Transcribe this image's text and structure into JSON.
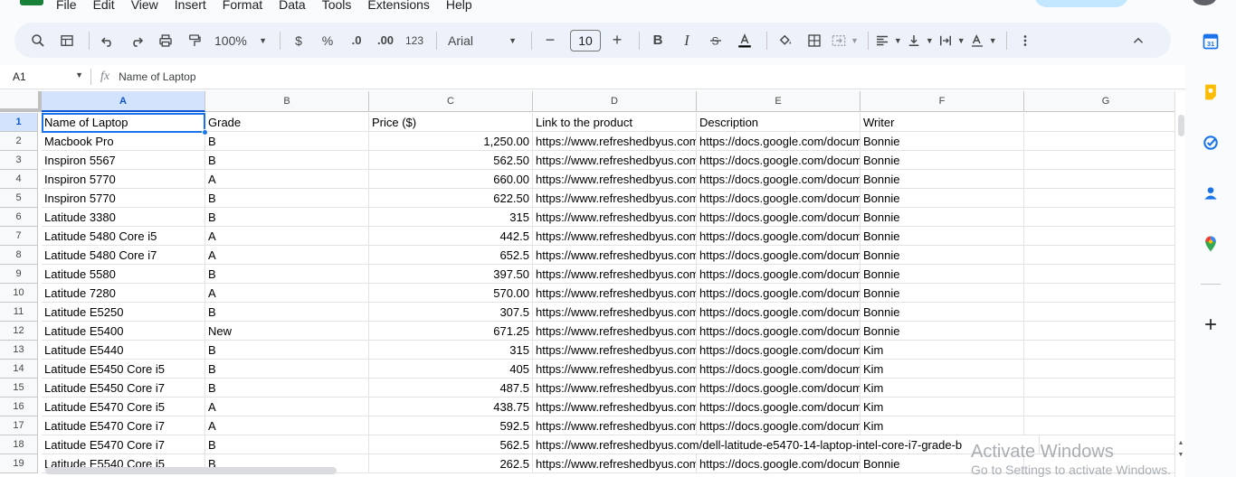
{
  "menu": [
    "File",
    "Edit",
    "View",
    "Insert",
    "Format",
    "Data",
    "Tools",
    "Extensions",
    "Help"
  ],
  "toolbar": {
    "zoom": "100%",
    "currency": "$",
    "percent": "%",
    "decrease_decimal": ".0",
    "increase_decimal": ".00",
    "more_formats": "123",
    "font_family": "Arial",
    "font_size": "10",
    "minus": "−",
    "plus": "+",
    "bold": "B",
    "italic": "I"
  },
  "formula_bar": {
    "name_box": "A1",
    "fx": "fx",
    "value": "Name of Laptop"
  },
  "columns": [
    "A",
    "B",
    "C",
    "D",
    "E",
    "F",
    "G"
  ],
  "rows": [
    {
      "n": "1",
      "a": "Name of Laptop",
      "b": "Grade",
      "c": "Price ($)",
      "d": "Link to the product",
      "e": "Description",
      "f": "Writer"
    },
    {
      "n": "2",
      "a": "Macbook Pro",
      "b": "B",
      "c": "1,250.00",
      "d": "https://www.refreshedbyus.com",
      "e": "https://docs.google.com/document",
      "f": "Bonnie"
    },
    {
      "n": "3",
      "a": "Inspiron 5567",
      "b": "B",
      "c": "562.50",
      "d": "https://www.refreshedbyus.com",
      "e": "https://docs.google.com/document",
      "f": "Bonnie"
    },
    {
      "n": "4",
      "a": "Inspiron 5770",
      "b": "A",
      "c": "660.00",
      "d": "https://www.refreshedbyus.com",
      "e": "https://docs.google.com/document",
      "f": "Bonnie"
    },
    {
      "n": "5",
      "a": "Inspiron 5770",
      "b": "B",
      "c": "622.50",
      "d": "https://www.refreshedbyus.com",
      "e": "https://docs.google.com/document",
      "f": "Bonnie"
    },
    {
      "n": "6",
      "a": "Latitude 3380",
      "b": "B",
      "c": "315",
      "d": "https://www.refreshedbyus.com",
      "e": "https://docs.google.com/document",
      "f": "Bonnie"
    },
    {
      "n": "7",
      "a": "Latitude 5480 Core i5",
      "b": "A",
      "c": "442.5",
      "d": "https://www.refreshedbyus.com",
      "e": "https://docs.google.com/document",
      "f": "Bonnie"
    },
    {
      "n": "8",
      "a": "Latitude 5480 Core i7",
      "b": "A",
      "c": "652.5",
      "d": "https://www.refreshedbyus.com",
      "e": "https://docs.google.com/document",
      "f": "Bonnie"
    },
    {
      "n": "9",
      "a": "Latitude 5580",
      "b": "B",
      "c": "397.50",
      "d": "https://www.refreshedbyus.com",
      "e": "https://docs.google.com/document",
      "f": "Bonnie"
    },
    {
      "n": "10",
      "a": "Latitude 7280",
      "b": "A",
      "c": "570.00",
      "d": "https://www.refreshedbyus.com",
      "e": "https://docs.google.com/document",
      "f": "Bonnie"
    },
    {
      "n": "11",
      "a": "Latitude E5250",
      "b": "B",
      "c": "307.5",
      "d": "https://www.refreshedbyus.com",
      "e": "https://docs.google.com/document",
      "f": "Bonnie"
    },
    {
      "n": "12",
      "a": "Latitude E5400",
      "b": "New",
      "c": "671.25",
      "d": "https://www.refreshedbyus.com",
      "e": "https://docs.google.com/document",
      "f": "Bonnie"
    },
    {
      "n": "13",
      "a": "Latitude E5440",
      "b": "B",
      "c": "315",
      "d": "https://www.refreshedbyus.com",
      "e": "https://docs.google.com/document",
      "f": "Kim"
    },
    {
      "n": "14",
      "a": "Latitude E5450 Core i5",
      "b": "B",
      "c": "405",
      "d": "https://www.refreshedbyus.com",
      "e": "https://docs.google.com/document",
      "f": "Kim"
    },
    {
      "n": "15",
      "a": "Latitude E5450 Core i7",
      "b": "B",
      "c": "487.5",
      "d": "https://www.refreshedbyus.com",
      "e": "https://docs.google.com/document",
      "f": "Kim"
    },
    {
      "n": "16",
      "a": "Latitude E5470 Core i5",
      "b": "A",
      "c": "438.75",
      "d": "https://www.refreshedbyus.com",
      "e": "https://docs.google.com/document",
      "f": "Kim"
    },
    {
      "n": "17",
      "a": "Latitude E5470 Core i7",
      "b": "A",
      "c": "592.5",
      "d": "https://www.refreshedbyus.com",
      "e": "https://docs.google.com/document",
      "f": "Kim"
    },
    {
      "n": "18",
      "a": "Latitude E5470 Core i7",
      "b": "B",
      "c": "562.5",
      "d": "https://www.refreshedbyus.com/dell-latitude-e5470-14-laptop-intel-core-i7-grade-b",
      "e": "",
      "f": ""
    },
    {
      "n": "19",
      "a": "Latitude E5540 Core i5",
      "b": "B",
      "c": "262.5",
      "d": "https://www.refreshedbyus.com",
      "e": "https://docs.google.com/document",
      "f": "Bonnie"
    }
  ],
  "watermark": {
    "title": "Activate Windows",
    "subtitle": "Go to Settings to activate Windows."
  },
  "colors": {
    "accent": "#1a73e8",
    "toolbar_bg": "#edf2fa",
    "sheets_green": "#188038"
  },
  "side_panel": [
    "calendar-icon",
    "keep-icon",
    "tasks-icon",
    "contacts-icon",
    "maps-icon",
    "add-icon"
  ]
}
